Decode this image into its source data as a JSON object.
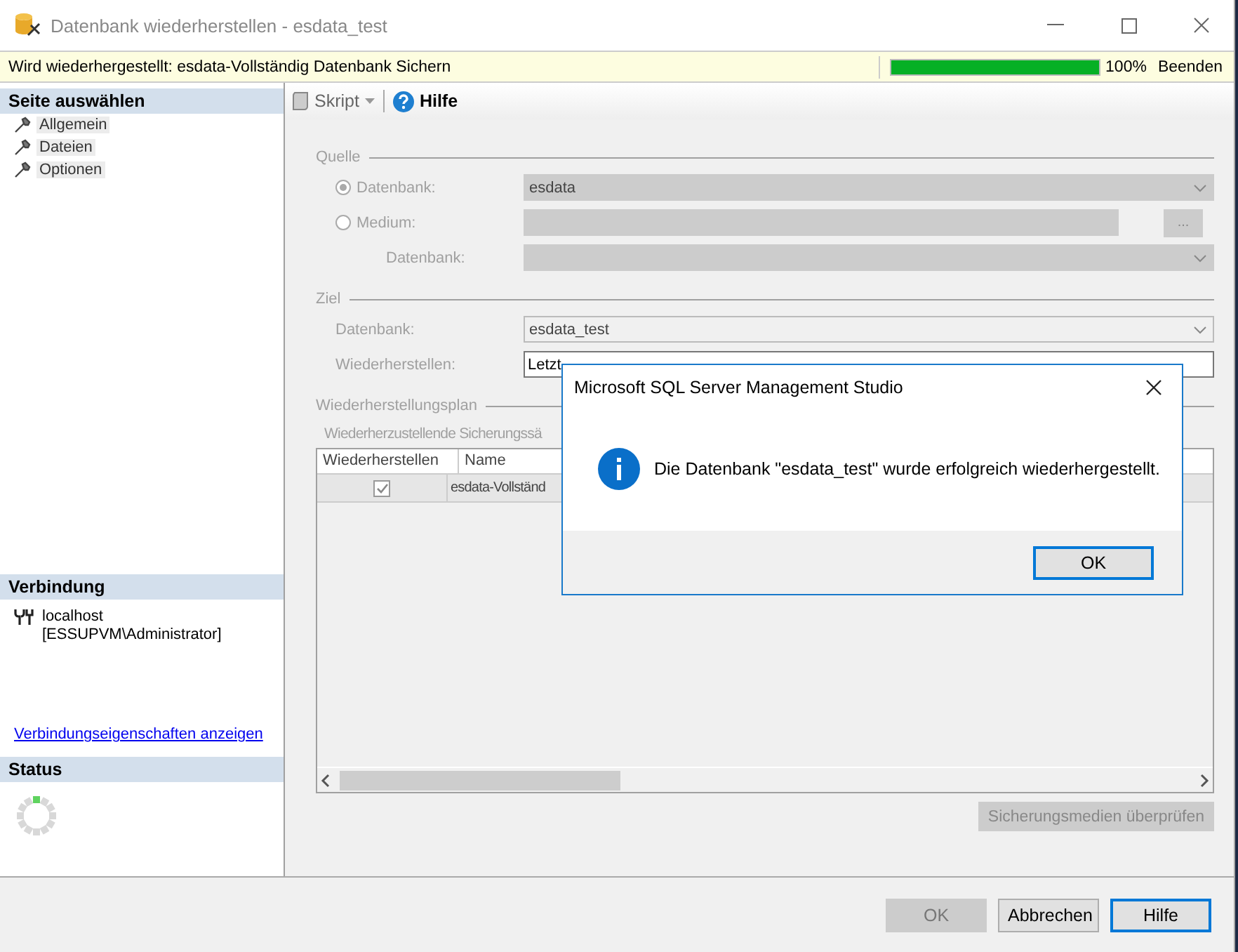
{
  "window": {
    "title": "Datenbank wiederherstellen - esdata_test"
  },
  "progress_bar": {
    "message": "Wird wiederhergestellt: esdata-Vollständig Datenbank Sichern",
    "level": 1,
    "percent": "100%",
    "status": "Beenden"
  },
  "sidebar": {
    "select_page": {
      "title": "Seite auswählen",
      "items": [
        "Allgemein",
        "Dateien",
        "Optionen"
      ]
    },
    "connection": {
      "title": "Verbindung",
      "server": "localhost",
      "user": "[ESSUPVM\\Administrator]",
      "link": "Verbindungseigenschaften anzeigen"
    },
    "status": {
      "title": "Status"
    }
  },
  "toolbar": {
    "items": [
      {
        "label": "Skript",
        "kind": "dropdown"
      },
      {
        "label": "Hilfe",
        "kind": "help"
      }
    ]
  },
  "source": {
    "title": "Quelle",
    "disabled": true,
    "options": [
      {
        "label": "Datenbank:",
        "selected": true,
        "value": "esdata"
      },
      {
        "label": "Medium:",
        "selected": false
      }
    ],
    "browse_button": "...",
    "database_label": "Datenbank:"
  },
  "target": {
    "title": "Ziel",
    "database_label": "Datenbank:",
    "database": "esdata_test",
    "restore_label": "Wiederherstellen:",
    "restore_value": "Letzt"
  },
  "plan": {
    "title": "Wiederherstellungsplan",
    "subtitle": "Wiederherzustellende Sicherungssä",
    "columns": [
      "Wiederherstellen",
      "Name"
    ],
    "rows": [
      {
        "restore": true,
        "name": "esdata-Vollständ"
      }
    ],
    "verify_button": "Sicherungsmedien überprüfen"
  },
  "buttons": [
    {
      "label": "OK",
      "disabled": true,
      "focused": false
    },
    {
      "label": "Abbrechen",
      "disabled": false,
      "focused": false
    },
    {
      "label": "Hilfe",
      "disabled": false,
      "focused": true
    }
  ],
  "message_box": {
    "title": "Microsoft SQL Server Management Studio",
    "text": "Die Datenbank \"esdata_test\" wurde erfolgreich wiederhergestellt.",
    "button": "OK"
  }
}
